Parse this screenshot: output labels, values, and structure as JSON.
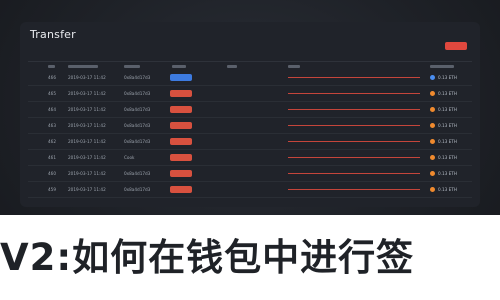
{
  "app": {
    "title": "Transfer"
  },
  "colors": {
    "accent": "#e0483e",
    "link": "#c4453b",
    "pill_blue": "#3d7be0",
    "pill_red": "#d8513f",
    "dot_blue": "#4a8ef0",
    "dot_orange": "#f08a2e"
  },
  "table": {
    "rows": [
      {
        "num": "466",
        "date": "2019-03-17 11:42",
        "method": "0x8a4d17d3",
        "status": "",
        "status_color": "#3d7be0",
        "amount": "0.13 ETH",
        "dot": "#4a8ef0"
      },
      {
        "num": "465",
        "date": "2019-03-17 11:42",
        "method": "0x8a4d17d3",
        "status": "",
        "status_color": "#d8513f",
        "amount": "0.13 ETH",
        "dot": "#f08a2e"
      },
      {
        "num": "464",
        "date": "2019-03-17 11:42",
        "method": "0x8a4d17d3",
        "status": "",
        "status_color": "#d8513f",
        "amount": "0.13 ETH",
        "dot": "#f08a2e"
      },
      {
        "num": "463",
        "date": "2019-03-17 11:42",
        "method": "0x8a4d17d3",
        "status": "",
        "status_color": "#d8513f",
        "amount": "0.13 ETH",
        "dot": "#f08a2e"
      },
      {
        "num": "462",
        "date": "2019-03-17 11:42",
        "method": "0x8a4d17d3",
        "status": "",
        "status_color": "#d8513f",
        "amount": "0.13 ETH",
        "dot": "#f08a2e"
      },
      {
        "num": "461",
        "date": "2019-03-17 11:42",
        "method": "Cook",
        "status": "",
        "status_color": "#d8513f",
        "amount": "0.13 ETH",
        "dot": "#f08a2e"
      },
      {
        "num": "460",
        "date": "2019-03-17 11:42",
        "method": "0x8a4d17d3",
        "status": "",
        "status_color": "#d8513f",
        "amount": "0.13 ETH",
        "dot": "#f08a2e"
      },
      {
        "num": "459",
        "date": "2019-03-17 11:42",
        "method": "0x8a4d17d3",
        "status": "",
        "status_color": "#d8513f",
        "amount": "0.13 ETH",
        "dot": "#f08a2e"
      }
    ]
  },
  "article": {
    "title": "V2:如何在钱包中进行签"
  }
}
